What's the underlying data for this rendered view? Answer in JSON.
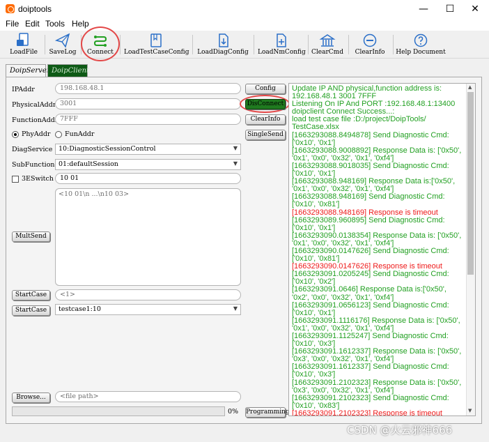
{
  "app": {
    "title": "doiptools"
  },
  "window": {
    "minimize": "—",
    "maximize": "☐",
    "close": "✕"
  },
  "menu": [
    "File",
    "Edit",
    "Tools",
    "Help"
  ],
  "toolbar": [
    {
      "label": "LoadFile",
      "icon": "load-file-icon"
    },
    {
      "label": "SaveLog",
      "icon": "send-icon"
    },
    {
      "label": "Connect",
      "icon": "connect-icon"
    },
    {
      "label": "LoadTestCaseConfig",
      "icon": "book-icon"
    },
    {
      "label": "LoadDiagConfig",
      "icon": "download-file-icon"
    },
    {
      "label": "LoadNmConfig",
      "icon": "add-file-icon"
    },
    {
      "label": "ClearCmd",
      "icon": "building-icon"
    },
    {
      "label": "ClearInfo",
      "icon": "minus-circle-icon"
    },
    {
      "label": "Help Document",
      "icon": "help-icon"
    }
  ],
  "tabs": [
    "DoipServer",
    "DoipClient"
  ],
  "form": {
    "ipaddr_label": "IPAddr",
    "ipaddr_value": "198.168.48.1",
    "physical_label": "PhysicalAddr",
    "physical_value": "3001",
    "function_label": "FunctionAddr",
    "function_value": "7FFF",
    "phy_radio": "PhyAddr",
    "fun_radio": "FunAddr",
    "diag_label": "DiagService",
    "diag_value": "10:DiagnosticSessionControl",
    "subfunc_label": "SubFunction",
    "subfunc_value": "01:defaultSession",
    "switch_label": "3ESwitch",
    "switch_value": "10 01",
    "multi_placeholder": "<10 01\\n   ...\\n10 03>",
    "startcase1_value": "<1>",
    "startcase2_value": "testcase1:10",
    "file_placeholder": "<file path>",
    "progress": "0%"
  },
  "buttons": {
    "config": "Config",
    "disconnect": "DisConnect",
    "clearinfo": "ClearInfo",
    "singlesend": "SingleSend",
    "multsend": "MultSend",
    "startcase": "StartCase",
    "browse": "Browse...",
    "programming": "Programming"
  },
  "log": [
    {
      "c": "g",
      "t": "Update IP AND physical,function address is: 192.168.48.1 3001 7FFF"
    },
    {
      "c": "g",
      "t": "Listening On IP And PORT :192.168.48.1:13400"
    },
    {
      "c": "g",
      "t": "doipclient Connect Success...:"
    },
    {
      "c": "g",
      "t": "load test case file :D:/project/DoipTools/ TestCase.xlsx"
    },
    {
      "c": "g",
      "t": "[1663293088.8494878] Send Diagnostic Cmd: ['0x10', '0x1']"
    },
    {
      "c": "g",
      "t": "[1663293088.9008892] Response Data is: ['0x50', '0x1', '0x0', '0x32', '0x1', '0xf4']"
    },
    {
      "c": "g",
      "t": "[1663293088.9018035] Send Diagnostic Cmd: ['0x10', '0x1']"
    },
    {
      "c": "g",
      "t": "[1663293088.948169] Response Data is:['0x50', '0x1', '0x0', '0x32', '0x1', '0xf4']"
    },
    {
      "c": "g",
      "t": "[1663293088.948169] Send Diagnostic Cmd: ['0x10', '0x81']"
    },
    {
      "c": "r",
      "t": "[1663293088.948169] Response is timeout"
    },
    {
      "c": "g",
      "t": "[1663293089.960895] Send Diagnostic Cmd: ['0x10', '0x1']"
    },
    {
      "c": "g",
      "t": "[1663293090.0138354] Response Data is: ['0x50', '0x1', '0x0', '0x32', '0x1', '0xf4']"
    },
    {
      "c": "g",
      "t": "[1663293090.0147626] Send Diagnostic Cmd: ['0x10', '0x81']"
    },
    {
      "c": "r",
      "t": "[1663293090.0147626] Response is timeout"
    },
    {
      "c": "g",
      "t": "[1663293091.0205245] Send Diagnostic Cmd: ['0x10', '0x2']"
    },
    {
      "c": "g",
      "t": "[1663293091.0646] Response Data is:['0x50', '0x2', '0x0', '0x32', '0x1', '0xf4']"
    },
    {
      "c": "g",
      "t": "[1663293091.0656123] Send Diagnostic Cmd: ['0x10', '0x1']"
    },
    {
      "c": "g",
      "t": "[1663293091.1116176] Response Data is: ['0x50', '0x1', '0x0', '0x32', '0x1', '0xf4']"
    },
    {
      "c": "g",
      "t": "[1663293091.1125247] Send Diagnostic Cmd: ['0x10', '0x3']"
    },
    {
      "c": "g",
      "t": "[1663293091.1612337] Response Data is: ['0x50', '0x3', '0x0', '0x32', '0x1', '0xf4']"
    },
    {
      "c": "g",
      "t": "[1663293091.1612337] Send Diagnostic Cmd: ['0x10', '0x3']"
    },
    {
      "c": "g",
      "t": "[1663293091.2102323] Response Data is: ['0x50', '0x3', '0x0', '0x32', '0x1', '0xf4']"
    },
    {
      "c": "g",
      "t": "[1663293091.2102323] Send Diagnostic Cmd: ['0x10', '0x83']"
    },
    {
      "c": "r",
      "t": "[1663293091.2102323] Response is timeout"
    }
  ],
  "watermark": "CSDN @火云邪神666",
  "colors": {
    "disconnect_bg": "#1f7a1f",
    "client_tab_bg": "#0e5a16",
    "log_ok": "#22a022",
    "log_err": "#ee1a1a",
    "highlight_ring": "#e34848"
  }
}
